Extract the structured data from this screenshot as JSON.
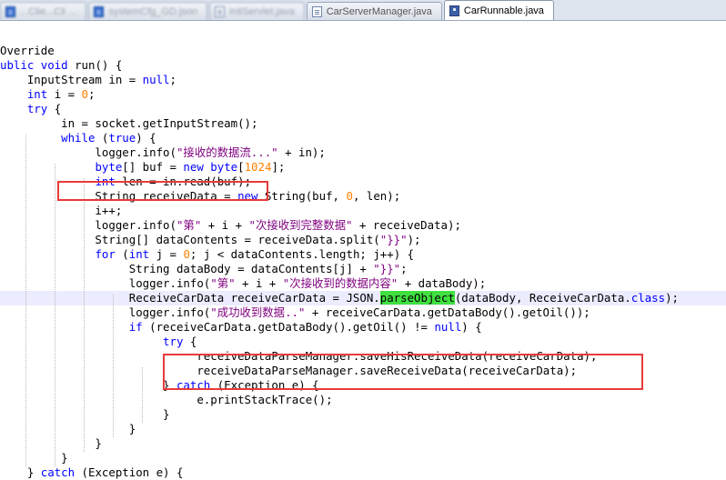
{
  "tabs": [
    {
      "label": "...Clie...Cli  ...",
      "icon": "json-file-icon",
      "active": false,
      "blurred": true
    },
    {
      "label": "systemCfg_GD.json",
      "icon": "json-file-icon",
      "active": false,
      "blurred": true
    },
    {
      "label": "initServlet.java",
      "icon": "java-file-icon",
      "active": false,
      "blurred": true
    },
    {
      "label": "CarServerManager.java",
      "icon": "java-file-icon",
      "active": false,
      "blurred": false
    },
    {
      "label": "CarRunnable.java",
      "icon": "save-disk-icon",
      "active": true,
      "blurred": false
    }
  ],
  "code": {
    "lines": [
      {
        "tokens": [
          {
            "t": "Override"
          }
        ]
      },
      {
        "tokens": [
          {
            "t": "ublic ",
            "c": "kw"
          },
          {
            "t": "void ",
            "c": "kw"
          },
          {
            "t": "run() {"
          }
        ]
      },
      {
        "tokens": [
          {
            "t": "    InputStream in = "
          },
          {
            "t": "null",
            "c": "kw"
          },
          {
            "t": ";"
          }
        ]
      },
      {
        "tokens": [
          {
            "t": "    "
          },
          {
            "t": "int",
            "c": "kw"
          },
          {
            "t": " i = "
          },
          {
            "t": "0",
            "c": "num"
          },
          {
            "t": ";"
          }
        ]
      },
      {
        "tokens": [
          {
            "t": "    "
          },
          {
            "t": "try",
            "c": "kw"
          },
          {
            "t": " {"
          }
        ]
      },
      {
        "tokens": [
          {
            "t": "         in = socket.getInputStream();"
          }
        ]
      },
      {
        "tokens": [
          {
            "t": "         "
          },
          {
            "t": "while",
            "c": "kw"
          },
          {
            "t": " ("
          },
          {
            "t": "true",
            "c": "kw"
          },
          {
            "t": ") {"
          }
        ]
      },
      {
        "tokens": [
          {
            "t": "              logger.info("
          },
          {
            "t": "\"接收的数据流...\"",
            "c": "str"
          },
          {
            "t": " + in);"
          }
        ]
      },
      {
        "tokens": [
          {
            "t": "              "
          },
          {
            "t": "byte",
            "c": "kw"
          },
          {
            "t": "[] buf = "
          },
          {
            "t": "new",
            "c": "kw"
          },
          {
            "t": " "
          },
          {
            "t": "byte",
            "c": "kw"
          },
          {
            "t": "["
          },
          {
            "t": "1024",
            "c": "num"
          },
          {
            "t": "];"
          }
        ]
      },
      {
        "tokens": [
          {
            "t": "              "
          },
          {
            "t": "int",
            "c": "kw"
          },
          {
            "t": " len = in.read(buf);"
          }
        ]
      },
      {
        "tokens": [
          {
            "t": "              String receiveData = "
          },
          {
            "t": "new",
            "c": "kw"
          },
          {
            "t": " String(buf, "
          },
          {
            "t": "0",
            "c": "num"
          },
          {
            "t": ", len);"
          }
        ]
      },
      {
        "tokens": [
          {
            "t": "              i++;"
          }
        ]
      },
      {
        "tokens": [
          {
            "t": "              logger.info("
          },
          {
            "t": "\"第\"",
            "c": "str"
          },
          {
            "t": " + i + "
          },
          {
            "t": "\"次接收到完整数据\"",
            "c": "str"
          },
          {
            "t": " + receiveData);"
          }
        ]
      },
      {
        "tokens": [
          {
            "t": "              String[] dataContents = receiveData.split("
          },
          {
            "t": "\"}}\"",
            "c": "str"
          },
          {
            "t": ");"
          }
        ]
      },
      {
        "tokens": [
          {
            "t": "              "
          },
          {
            "t": "for",
            "c": "kw"
          },
          {
            "t": " ("
          },
          {
            "t": "int",
            "c": "kw"
          },
          {
            "t": " j = "
          },
          {
            "t": "0",
            "c": "num"
          },
          {
            "t": "; j < dataContents.length; j++) {"
          }
        ]
      },
      {
        "tokens": [
          {
            "t": "                   String dataBody = dataContents[j] + "
          },
          {
            "t": "\"}}\"",
            "c": "str"
          },
          {
            "t": ";"
          }
        ]
      },
      {
        "tokens": [
          {
            "t": "                   logger.info("
          },
          {
            "t": "\"第\"",
            "c": "str"
          },
          {
            "t": " + i + "
          },
          {
            "t": "\"次接收到的数据内容\"",
            "c": "str"
          },
          {
            "t": " + dataBody);"
          }
        ]
      },
      {
        "current": true,
        "tokens": [
          {
            "t": "                   ReceiveCarData receiveCarData = JSON."
          },
          {
            "t": "parseObject",
            "c": "hl"
          },
          {
            "t": "(dataBody, ReceiveCarData."
          },
          {
            "t": "class",
            "c": "kw"
          },
          {
            "t": ");"
          }
        ]
      },
      {
        "tokens": [
          {
            "t": "                   logger.info("
          },
          {
            "t": "\"成功收到数据..\"",
            "c": "str"
          },
          {
            "t": " + receiveCarData.getDataBody().getOil());"
          }
        ]
      },
      {
        "tokens": [
          {
            "t": "                   "
          },
          {
            "t": "if",
            "c": "kw"
          },
          {
            "t": " (receiveCarData.getDataBody().getOil() != "
          },
          {
            "t": "null",
            "c": "kw"
          },
          {
            "t": ") {"
          }
        ]
      },
      {
        "tokens": [
          {
            "t": "                        "
          },
          {
            "t": "try",
            "c": "kw"
          },
          {
            "t": " {"
          }
        ]
      },
      {
        "tokens": [
          {
            "t": "                             receiveDataParseManager.saveHisReceiveData(receiveCarData);"
          }
        ]
      },
      {
        "tokens": [
          {
            "t": "                             receiveDataParseManager.saveReceiveData(receiveCarData);"
          }
        ]
      },
      {
        "tokens": [
          {
            "t": "                        } "
          },
          {
            "t": "catch",
            "c": "kw"
          },
          {
            "t": " (Exception e) {"
          }
        ]
      },
      {
        "tokens": [
          {
            "t": "                             e.printStackTrace();"
          }
        ]
      },
      {
        "tokens": [
          {
            "t": "                        }"
          }
        ]
      },
      {
        "tokens": [
          {
            "t": "                   }"
          }
        ]
      },
      {
        "tokens": [
          {
            "t": "              }"
          }
        ]
      },
      {
        "tokens": [
          {
            "t": "         }"
          }
        ]
      },
      {
        "tokens": [
          {
            "t": "    } "
          },
          {
            "t": "catch",
            "c": "kw"
          },
          {
            "t": " (Exception e) {"
          }
        ]
      }
    ]
  },
  "colors": {
    "keyword": "#0000ff",
    "string": "#7f007f",
    "number": "#ff8000",
    "highlight": "#40e040",
    "current_line": "#ececff",
    "annotation_box": "#e83a3a"
  }
}
